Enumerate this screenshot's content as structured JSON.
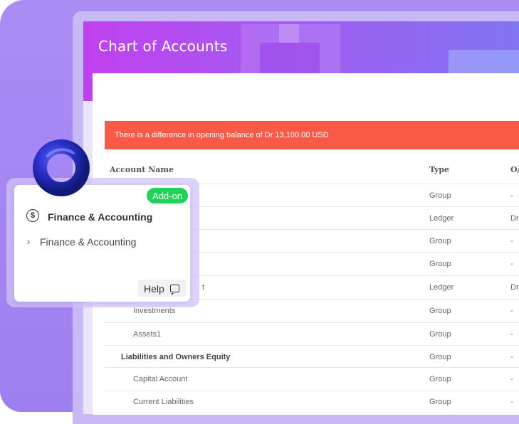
{
  "header": {
    "title": "Chart of Accounts"
  },
  "alert": {
    "message": "There is a difference in opening balance of Dr 13,100.00 USD"
  },
  "table": {
    "columns": [
      "Account Name",
      "Type",
      "O/"
    ],
    "rows": [
      {
        "name": "",
        "type": "Group",
        "ob": "-"
      },
      {
        "name": "",
        "type": "Ledger",
        "ob": "Dr"
      },
      {
        "name": "",
        "type": "Group",
        "ob": "-"
      },
      {
        "name": "",
        "type": "Group",
        "ob": "-"
      },
      {
        "name": "t",
        "type": "Ledger",
        "ob": "Dr"
      },
      {
        "name": "Investments",
        "type": "Group",
        "ob": "-"
      },
      {
        "name": "Assets1",
        "type": "Group",
        "ob": "-"
      },
      {
        "name": "Liabilities and Owners Equity",
        "type": "Group",
        "ob": "-",
        "bold": true
      },
      {
        "name": "Capital Account",
        "type": "Group",
        "ob": "-"
      },
      {
        "name": "Current Liabilities",
        "type": "Group",
        "ob": "-"
      }
    ]
  },
  "popup": {
    "badge": "Add-on",
    "title": "Finance & Accounting",
    "item": "Finance & Accounting",
    "help": "Help"
  },
  "icons": {
    "dollar": "dollar-circle-icon",
    "chevron": "chevron-right-icon",
    "chat": "chat-bubble-icon"
  },
  "colors": {
    "alert": "#f85a47",
    "badge": "#1fd35a",
    "header_start": "#c040ee",
    "header_end": "#8074f2"
  }
}
